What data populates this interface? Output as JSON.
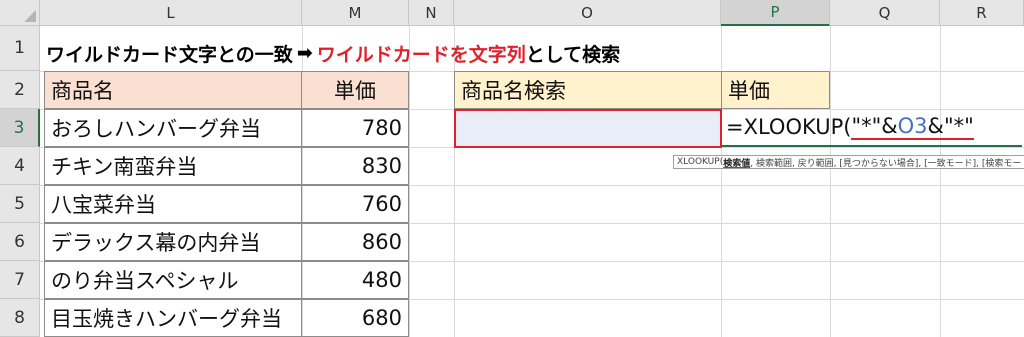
{
  "columns": [
    "L",
    "M",
    "N",
    "O",
    "P",
    "Q",
    "R"
  ],
  "rows": [
    "1",
    "2",
    "3",
    "4",
    "5",
    "6",
    "7",
    "8"
  ],
  "title": {
    "part1": "ワイルドカード文字との一致",
    "arrow": "➡",
    "part2_red": "ワイルドカードを文字列",
    "part3": "として検索"
  },
  "table": {
    "header_name": "商品名",
    "header_price": "単価",
    "rows": [
      {
        "name": "おろしハンバーグ弁当",
        "price": "780"
      },
      {
        "name": "チキン南蛮弁当",
        "price": "830"
      },
      {
        "name": "八宝菜弁当",
        "price": "760"
      },
      {
        "name": "デラックス幕の内弁当",
        "price": "860"
      },
      {
        "name": "のり弁当スペシャル",
        "price": "480"
      },
      {
        "name": "目玉焼きハンバーグ弁当",
        "price": "680"
      }
    ]
  },
  "search": {
    "header_name": "商品名検索",
    "header_price": "単価",
    "input_value": "",
    "formula_prefix": "=XLOOKUP(",
    "formula_str1": "\"*\"",
    "formula_amp1": "&",
    "formula_ref": "O3",
    "formula_amp2": "&",
    "formula_str2": "\"*\""
  },
  "tooltip": {
    "func": "XLOOKUP(",
    "arg_bold": "検索値",
    "rest": ", 検索範囲, 戻り範囲, [見つからない場合], [一致モード], [検索モード])"
  },
  "colors": {
    "header_fill": "#fbe0d2",
    "search_header_fill": "#fff2cc",
    "input_fill": "#e9edf7",
    "selection_red": "#e0202a",
    "ref_blue": "#4472c4",
    "excel_green": "#217346"
  }
}
